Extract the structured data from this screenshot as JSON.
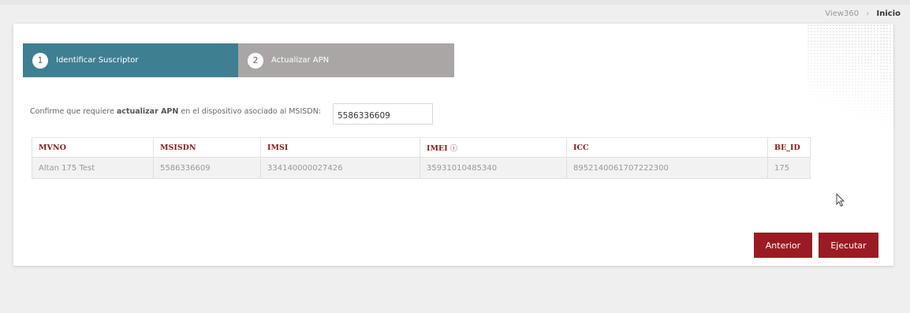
{
  "breadcrumb": {
    "parent": "View360",
    "separator": "›",
    "current": "Inicio"
  },
  "wizard": {
    "steps": [
      {
        "number": "1",
        "label": "Identificar Suscriptor",
        "active": true
      },
      {
        "number": "2",
        "label": "Actualizar APN",
        "active": false
      }
    ]
  },
  "confirm": {
    "prefix": "Confirme que requiere ",
    "bold": "actualizar APN",
    "suffix": " en el dispositivo asociado al MSISDN:",
    "msisdn_value": "5586336609"
  },
  "table": {
    "headers": [
      "MVNO",
      "MSISDN",
      "IMSI",
      "IMEI",
      "ICC",
      "BE_ID"
    ],
    "imei_info_icon": "ⓘ",
    "rows": [
      [
        "Altan 175 Test",
        "5586336609",
        "334140000027426",
        "35931010485340",
        "8952140061707222300",
        "175"
      ]
    ]
  },
  "buttons": {
    "previous": "Anterior",
    "execute": "Ejecutar"
  },
  "colors": {
    "step_active": "#3f7f92",
    "step_inactive": "#aaa6a6",
    "header_text": "#8b1a1a",
    "button": "#9b1b24"
  }
}
